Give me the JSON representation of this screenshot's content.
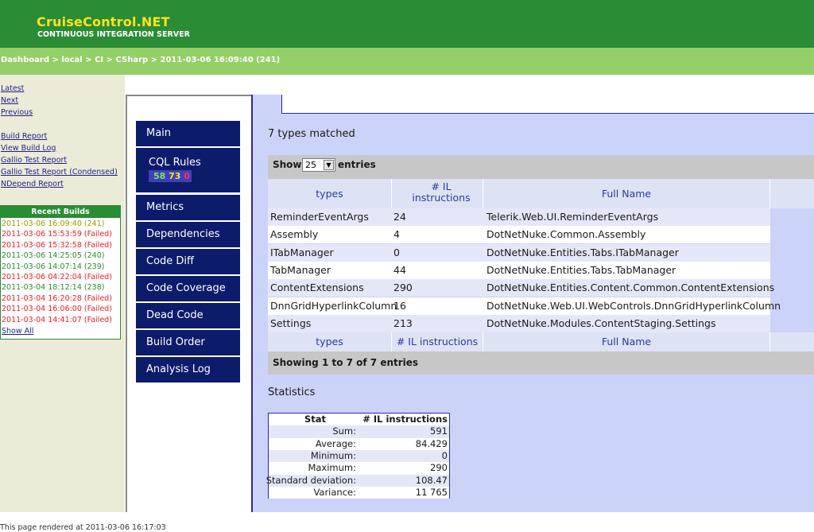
{
  "header": {
    "title": "CruiseControl.NET",
    "subtitle": "CONTINUOUS INTEGRATION SERVER"
  },
  "breadcrumb": {
    "text": "Dashboard > local > CI > CSharp > 2011-03-06 16:09:40 (241)"
  },
  "nav": {
    "latest": "Latest",
    "next": "Next",
    "previous": "Previous"
  },
  "reports": {
    "build_report": "Build Report",
    "view_build_log": "View Build Log",
    "gallio_test_report": "Gallio Test Report",
    "gallio_test_report_condensed": "Gallio Test Report (Condensed)",
    "ndepend_report": "NDepend Report"
  },
  "recent_builds": {
    "title": "Recent Builds",
    "items": [
      {
        "label": "2011-03-06 16:09:40 (241)",
        "color": "#9a9a00"
      },
      {
        "label": "2011-03-06 15:53:59 (Failed)",
        "color": "#e8202a"
      },
      {
        "label": "2011-03-06 15:32:58 (Failed)",
        "color": "#e8202a"
      },
      {
        "label": "2011-03-06 14:25:05 (240)",
        "color": "#2a8c35"
      },
      {
        "label": "2011-03-06 14:07:14 (239)",
        "color": "#2a8c35"
      },
      {
        "label": "2011-03-06 04:22:04 (Failed)",
        "color": "#e8202a"
      },
      {
        "label": "2011-03-04 18:12:14 (238)",
        "color": "#2a8c35"
      },
      {
        "label": "2011-03-04 16:20:28 (Failed)",
        "color": "#e8202a"
      },
      {
        "label": "2011-03-04 16:06:00 (Failed)",
        "color": "#e8202a"
      },
      {
        "label": "2011-03-04 14:41:07 (Failed)",
        "color": "#e8202a"
      }
    ],
    "show_all": "Show All"
  },
  "menu": {
    "main": "Main",
    "cql_rules": "CQL Rules",
    "cql_counts": {
      "green": "58",
      "yellow": "73",
      "red": "0"
    },
    "metrics": "Metrics",
    "dependencies": "Dependencies",
    "code_diff": "Code Diff",
    "code_coverage": "Code Coverage",
    "dead_code": "Dead Code",
    "build_order": "Build Order",
    "analysis_log": "Analysis Log"
  },
  "content": {
    "matched": "7 types matched",
    "show": "Show",
    "entries_value": "25",
    "entries": "entries",
    "columns": {
      "types": "types",
      "il_header": "# IL instructions",
      "full_name": "Full Name"
    },
    "rows": [
      {
        "type": "ReminderEventArgs",
        "il": "24",
        "full": "Telerik.Web.UI.ReminderEventArgs"
      },
      {
        "type": "Assembly",
        "il": "4",
        "full": "DotNetNuke.Common.Assembly"
      },
      {
        "type": "ITabManager",
        "il": "0",
        "full": "DotNetNuke.Entities.Tabs.ITabManager"
      },
      {
        "type": "TabManager",
        "il": "44",
        "full": "DotNetNuke.Entities.Tabs.TabManager"
      },
      {
        "type": "ContentExtensions",
        "il": "290",
        "full": "DotNetNuke.Entities.Content.Common.ContentExtensions"
      },
      {
        "type": "DnnGridHyperlinkColumn",
        "il": "16",
        "full": "DotNetNuke.Web.UI.WebControls.DnnGridHyperlinkColumn"
      },
      {
        "type": "Settings",
        "il": "213",
        "full": "DotNetNuke.Modules.ContentStaging.Settings"
      }
    ],
    "footer": "Showing 1 to 7 of 7 entries"
  },
  "statistics": {
    "title": "Statistics",
    "col_stat": "Stat",
    "col_il": "# IL instructions",
    "rows": [
      {
        "k": "Sum:",
        "v": "591"
      },
      {
        "k": "Average:",
        "v": "84.429"
      },
      {
        "k": "Minimum:",
        "v": "0"
      },
      {
        "k": "Maximum:",
        "v": "290"
      },
      {
        "k": "Standard deviation:",
        "v": "108.47"
      },
      {
        "k": "Variance:",
        "v": "11 765"
      }
    ]
  },
  "rendered": "This page rendered at 2011-03-06 16:17:03"
}
